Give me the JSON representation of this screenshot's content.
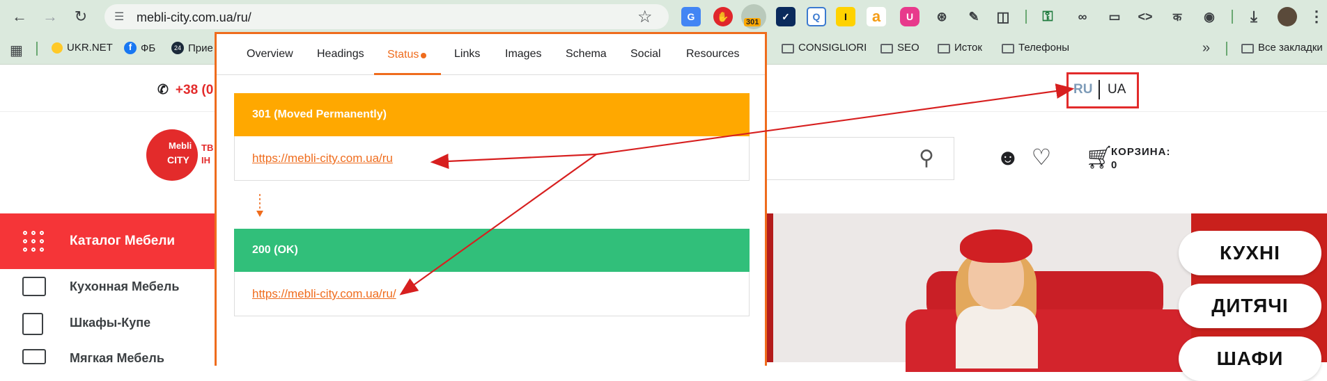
{
  "browser": {
    "url": "mebli-city.com.ua/ru/",
    "extensions": [
      {
        "name": "translate-icon",
        "badge": ""
      },
      {
        "name": "adblock-icon",
        "badge": ""
      },
      {
        "name": "redirect-checker-icon",
        "badge": "301"
      },
      {
        "name": "check-icon",
        "badge": ""
      },
      {
        "name": "seo-icon",
        "badge": ""
      },
      {
        "name": "i-icon",
        "badge": ""
      },
      {
        "name": "amazon-icon",
        "badge": ""
      },
      {
        "name": "u-icon",
        "badge": ""
      }
    ]
  },
  "bookmarks": [
    {
      "label": "UKR.NET",
      "type": "site"
    },
    {
      "label": "ФБ",
      "type": "site"
    },
    {
      "label": "Прие",
      "type": "site"
    },
    {
      "label": "CONSIGLIORI",
      "type": "folder"
    },
    {
      "label": "SEO",
      "type": "folder"
    },
    {
      "label": "Исток",
      "type": "folder"
    },
    {
      "label": "Телефоны",
      "type": "folder"
    },
    {
      "label": "Все закладки",
      "type": "folder"
    }
  ],
  "site": {
    "phone": "+38 (0",
    "lang": {
      "ru": "RU",
      "ua": "UA"
    },
    "logo": {
      "line1": "Mebli",
      "line2": "CITY",
      "side1": "ТВ",
      "side2": "ІН"
    },
    "cart": {
      "label": "КОРЗИНА:",
      "count": "0"
    },
    "catalog_label": "Каталог Мебели",
    "menu": [
      "Кухонная Мебель",
      "Шкафы-Купе",
      "Мягкая Мебель"
    ],
    "banner_pills": [
      "КУХНІ",
      "ДИТЯЧІ",
      "ШАФИ"
    ]
  },
  "panel": {
    "tabs": [
      "Overview",
      "Headings",
      "Status",
      "Links",
      "Images",
      "Schema",
      "Social",
      "Resources"
    ],
    "active_tab": "Status",
    "statuses": [
      {
        "code": "301 (Moved Permanently)",
        "url": "https://mebli-city.com.ua/ru",
        "color": "#ffa800"
      },
      {
        "code": "200 (OK)",
        "url": "https://mebli-city.com.ua/ru/",
        "color": "#31bf7a"
      }
    ]
  },
  "colors": {
    "accent": "#ef6c1d",
    "brand_red": "#e32b2b",
    "annotation": "#d71f1f"
  }
}
